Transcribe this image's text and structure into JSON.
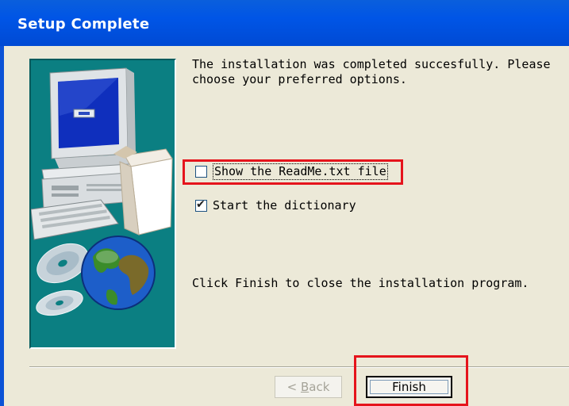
{
  "window": {
    "title": "Setup Complete"
  },
  "content": {
    "intro": "The installation was completed succesfully. Please\nchoose your preferred options.",
    "closing": "Click Finish to close the installation program."
  },
  "options": [
    {
      "label": "Show the ReadMe.txt file",
      "checked": false
    },
    {
      "label": "Start the dictionary",
      "checked": true
    }
  ],
  "buttons": {
    "back": {
      "label_prefix": "< ",
      "label_accel": "B",
      "label_rest": "ack",
      "enabled": false
    },
    "finish": {
      "label": "Finish",
      "enabled": true
    }
  },
  "icons": {
    "banner": [
      "desktop-computer-icon",
      "keyboard-icon",
      "open-box-icon",
      "cd-disc-icon",
      "globe-icon"
    ],
    "checkbox_tick": "✔"
  },
  "colors": {
    "titlebar": "#0054e3",
    "dialog_bg": "#ece9d8",
    "banner_bg": "#0b7f82",
    "highlight": "#e5141c"
  }
}
